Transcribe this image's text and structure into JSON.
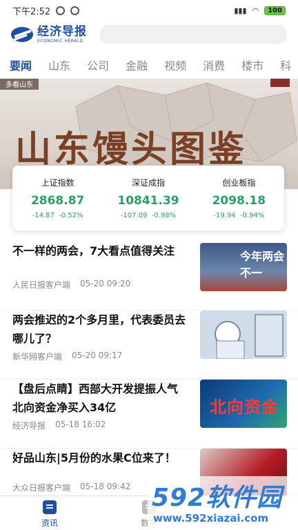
{
  "status_bar": {
    "time": "下午2:52",
    "battery": "100"
  },
  "app": {
    "logo_cn": "经济导报",
    "logo_en": "ECONOMIC HERALD"
  },
  "tabs": [
    {
      "label": "要闻",
      "active": true
    },
    {
      "label": "山东"
    },
    {
      "label": "公司"
    },
    {
      "label": "金融"
    },
    {
      "label": "视频"
    },
    {
      "label": "消费"
    },
    {
      "label": "楼市"
    },
    {
      "label": "科"
    }
  ],
  "banner": {
    "title": "山东馒头图鉴",
    "corner_text": "多看山东"
  },
  "indices": [
    {
      "name": "上证指数",
      "value": "2868.87",
      "change": "-14.87",
      "pct": "-0.52%"
    },
    {
      "name": "深证成指",
      "value": "10841.39",
      "change": "-107.09",
      "pct": "-0.98%"
    },
    {
      "name": "创业板指",
      "value": "2098.18",
      "change": "-19.94",
      "pct": "-0.94%"
    }
  ],
  "news": [
    {
      "title": "不一样的两会，7大看点值得关注",
      "source": "人民日报客户端",
      "time": "05-20 09:20"
    },
    {
      "title": "两会推迟的2个多月里，代表委员去哪儿了？",
      "source": "新华网客户端",
      "time": "05-20 09:17"
    },
    {
      "title": "【盘后点睛】西部大开发提振人气 北向资金净买入34亿",
      "source": "经济导报",
      "time": "05-18 16:02"
    },
    {
      "title": "好品山东|5月份的水果C位来了！",
      "source": "大众日报客户端",
      "time": "05-18 09:42"
    }
  ],
  "thumbs": {
    "t1_text": "今年两会 不一",
    "t2_text": "",
    "t3_text": "北向资金",
    "t4_text": ""
  },
  "bottom_nav": [
    {
      "label": "资讯",
      "active": true
    },
    {
      "label": "数字"
    }
  ],
  "watermark": {
    "brand": "592软件园",
    "url": "www.592xiazai.com"
  },
  "colors": {
    "brand": "#1e4f9e",
    "down": "#2aa061",
    "banner_title": "#7a3f24",
    "watermark": "#2f7cd6"
  }
}
